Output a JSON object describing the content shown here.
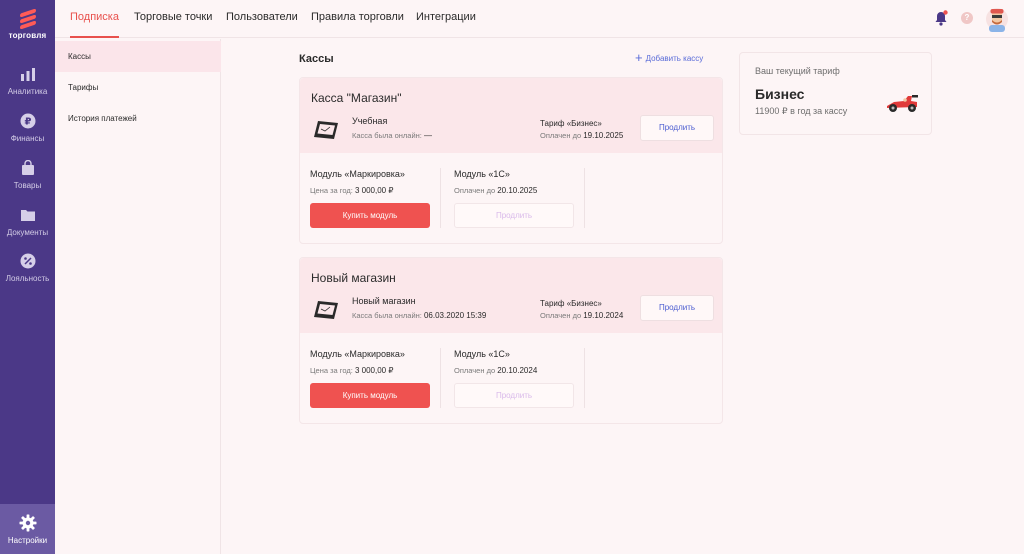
{
  "app": {
    "logo_text": "торговля"
  },
  "sidebar": {
    "items": [
      {
        "label": "Аналитика",
        "icon": "chart-bar-icon"
      },
      {
        "label": "Финансы",
        "icon": "ruble-coin-icon"
      },
      {
        "label": "Товары",
        "icon": "shopping-bag-icon"
      },
      {
        "label": "Документы",
        "icon": "folder-icon"
      },
      {
        "label": "Лояльность",
        "icon": "percent-badge-icon"
      }
    ],
    "settings_label": "Настройки"
  },
  "topnav": {
    "tabs": [
      {
        "label": "Подписка",
        "active": true
      },
      {
        "label": "Торговые точки"
      },
      {
        "label": "Пользователи"
      },
      {
        "label": "Правила торговли"
      },
      {
        "label": "Интеграции"
      }
    ],
    "help_label": "?"
  },
  "subnav": {
    "items": [
      {
        "label": "Кассы",
        "active": true
      },
      {
        "label": "Тарифы"
      },
      {
        "label": "История платежей"
      }
    ]
  },
  "main": {
    "section_title": "Кассы",
    "add_label": "Добавить кассу",
    "add_icon": "+",
    "cards": [
      {
        "title": "Касса \"Магазин\"",
        "store_name": "Учебная",
        "online_label": "Касса была онлайн:",
        "online_value": "—",
        "tariff_name": "Тариф «Бизнес»",
        "paid_label": "Оплачен до",
        "paid_value": "19.10.2025",
        "extend_label": "Продлить",
        "modules": [
          {
            "title": "Модуль «Маркировка»",
            "sub_label": "Цена за год:",
            "sub_value": "3 000,00 ₽",
            "button": "Купить модуль"
          },
          {
            "title": "Модуль «1С»",
            "sub_label": "Оплачен до",
            "sub_value": "20.10.2025",
            "button": "Продлить"
          }
        ]
      },
      {
        "title": "Новый магазин",
        "store_name": "Новый магазин",
        "online_label": "Касса была онлайн:",
        "online_value": "06.03.2020 15:39",
        "tariff_name": "Тариф «Бизнес»",
        "paid_label": "Оплачен до",
        "paid_value": "19.10.2024",
        "extend_label": "Продлить",
        "modules": [
          {
            "title": "Модуль «Маркировка»",
            "sub_label": "Цена за год:",
            "sub_value": "3 000,00 ₽",
            "button": "Купить модуль"
          },
          {
            "title": "Модуль «1С»",
            "sub_label": "Оплачен до",
            "sub_value": "20.10.2024",
            "button": "Продлить"
          }
        ]
      }
    ]
  },
  "tariff_panel": {
    "label": "Ваш текущий тариф",
    "name": "Бизнес",
    "price": "11900 ₽ в год за кассу"
  },
  "colors": {
    "accent": "#ef5250",
    "sidebar": "#4b3887",
    "link": "#5a6cd8"
  }
}
